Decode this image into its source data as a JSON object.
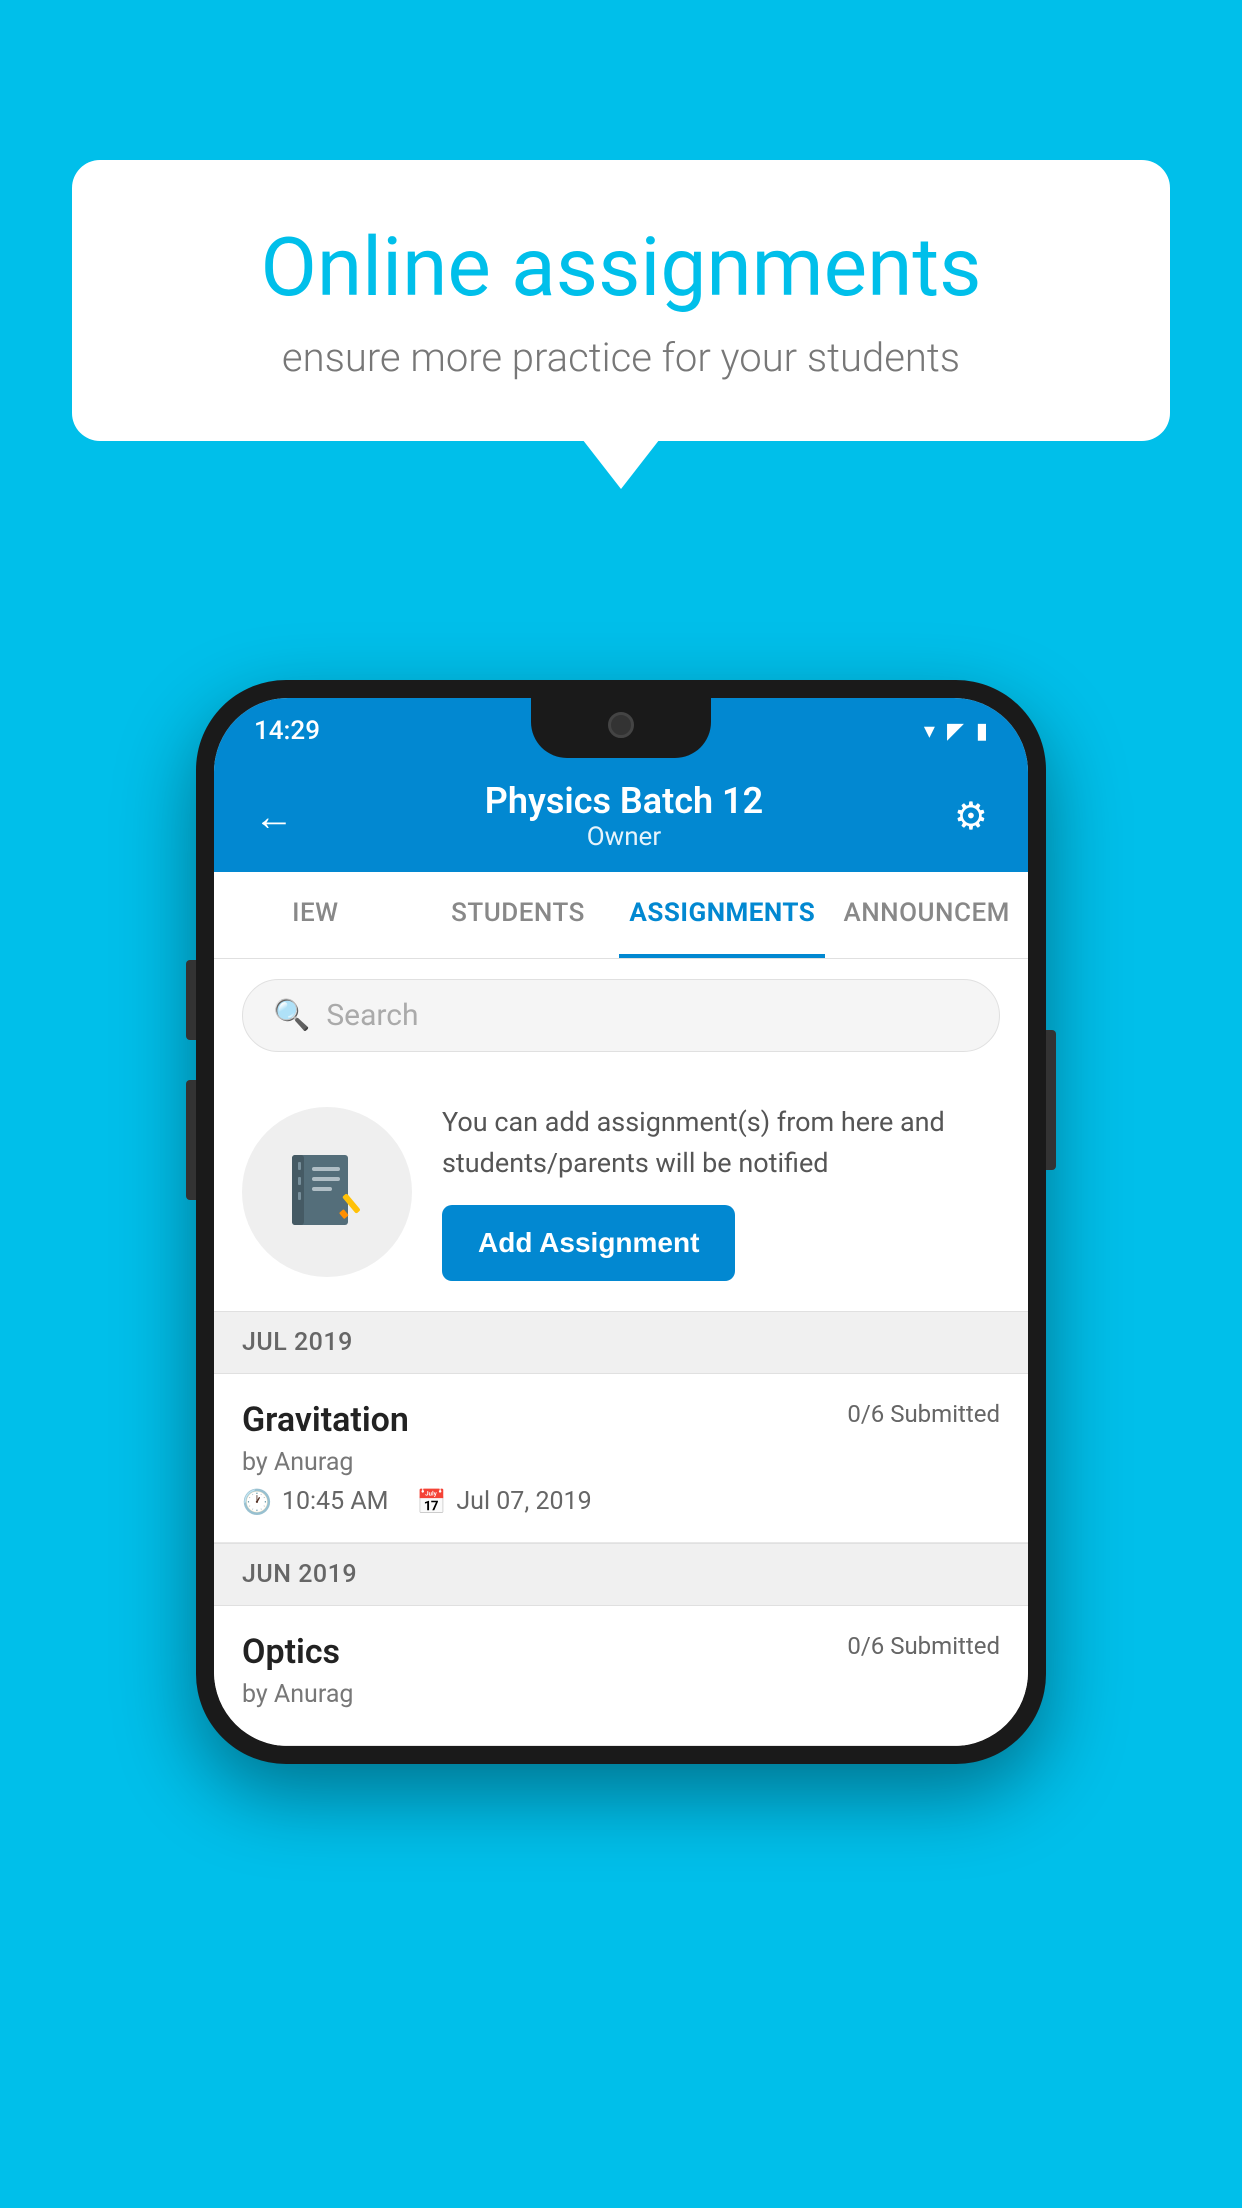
{
  "background_color": "#00BFEA",
  "speech_bubble": {
    "title": "Online assignments",
    "subtitle": "ensure more practice for your students"
  },
  "status_bar": {
    "time": "14:29",
    "icons": [
      "wifi",
      "signal",
      "battery"
    ]
  },
  "app_bar": {
    "title": "Physics Batch 12",
    "subtitle": "Owner",
    "back_icon": "←",
    "settings_icon": "⚙"
  },
  "tabs": [
    {
      "label": "IEW",
      "active": false
    },
    {
      "label": "STUDENTS",
      "active": false
    },
    {
      "label": "ASSIGNMENTS",
      "active": true
    },
    {
      "label": "ANNOUNCEM",
      "active": false
    }
  ],
  "search": {
    "placeholder": "Search"
  },
  "info_card": {
    "description": "You can add assignment(s) from here and students/parents will be notified",
    "button_label": "Add Assignment"
  },
  "sections": [
    {
      "label": "JUL 2019",
      "assignments": [
        {
          "title": "Gravitation",
          "submitted": "0/6 Submitted",
          "by": "by Anurag",
          "time": "10:45 AM",
          "date": "Jul 07, 2019"
        }
      ]
    },
    {
      "label": "JUN 2019",
      "assignments": [
        {
          "title": "Optics",
          "submitted": "0/6 Submitted",
          "by": "by Anurag",
          "time": "",
          "date": ""
        }
      ]
    }
  ]
}
